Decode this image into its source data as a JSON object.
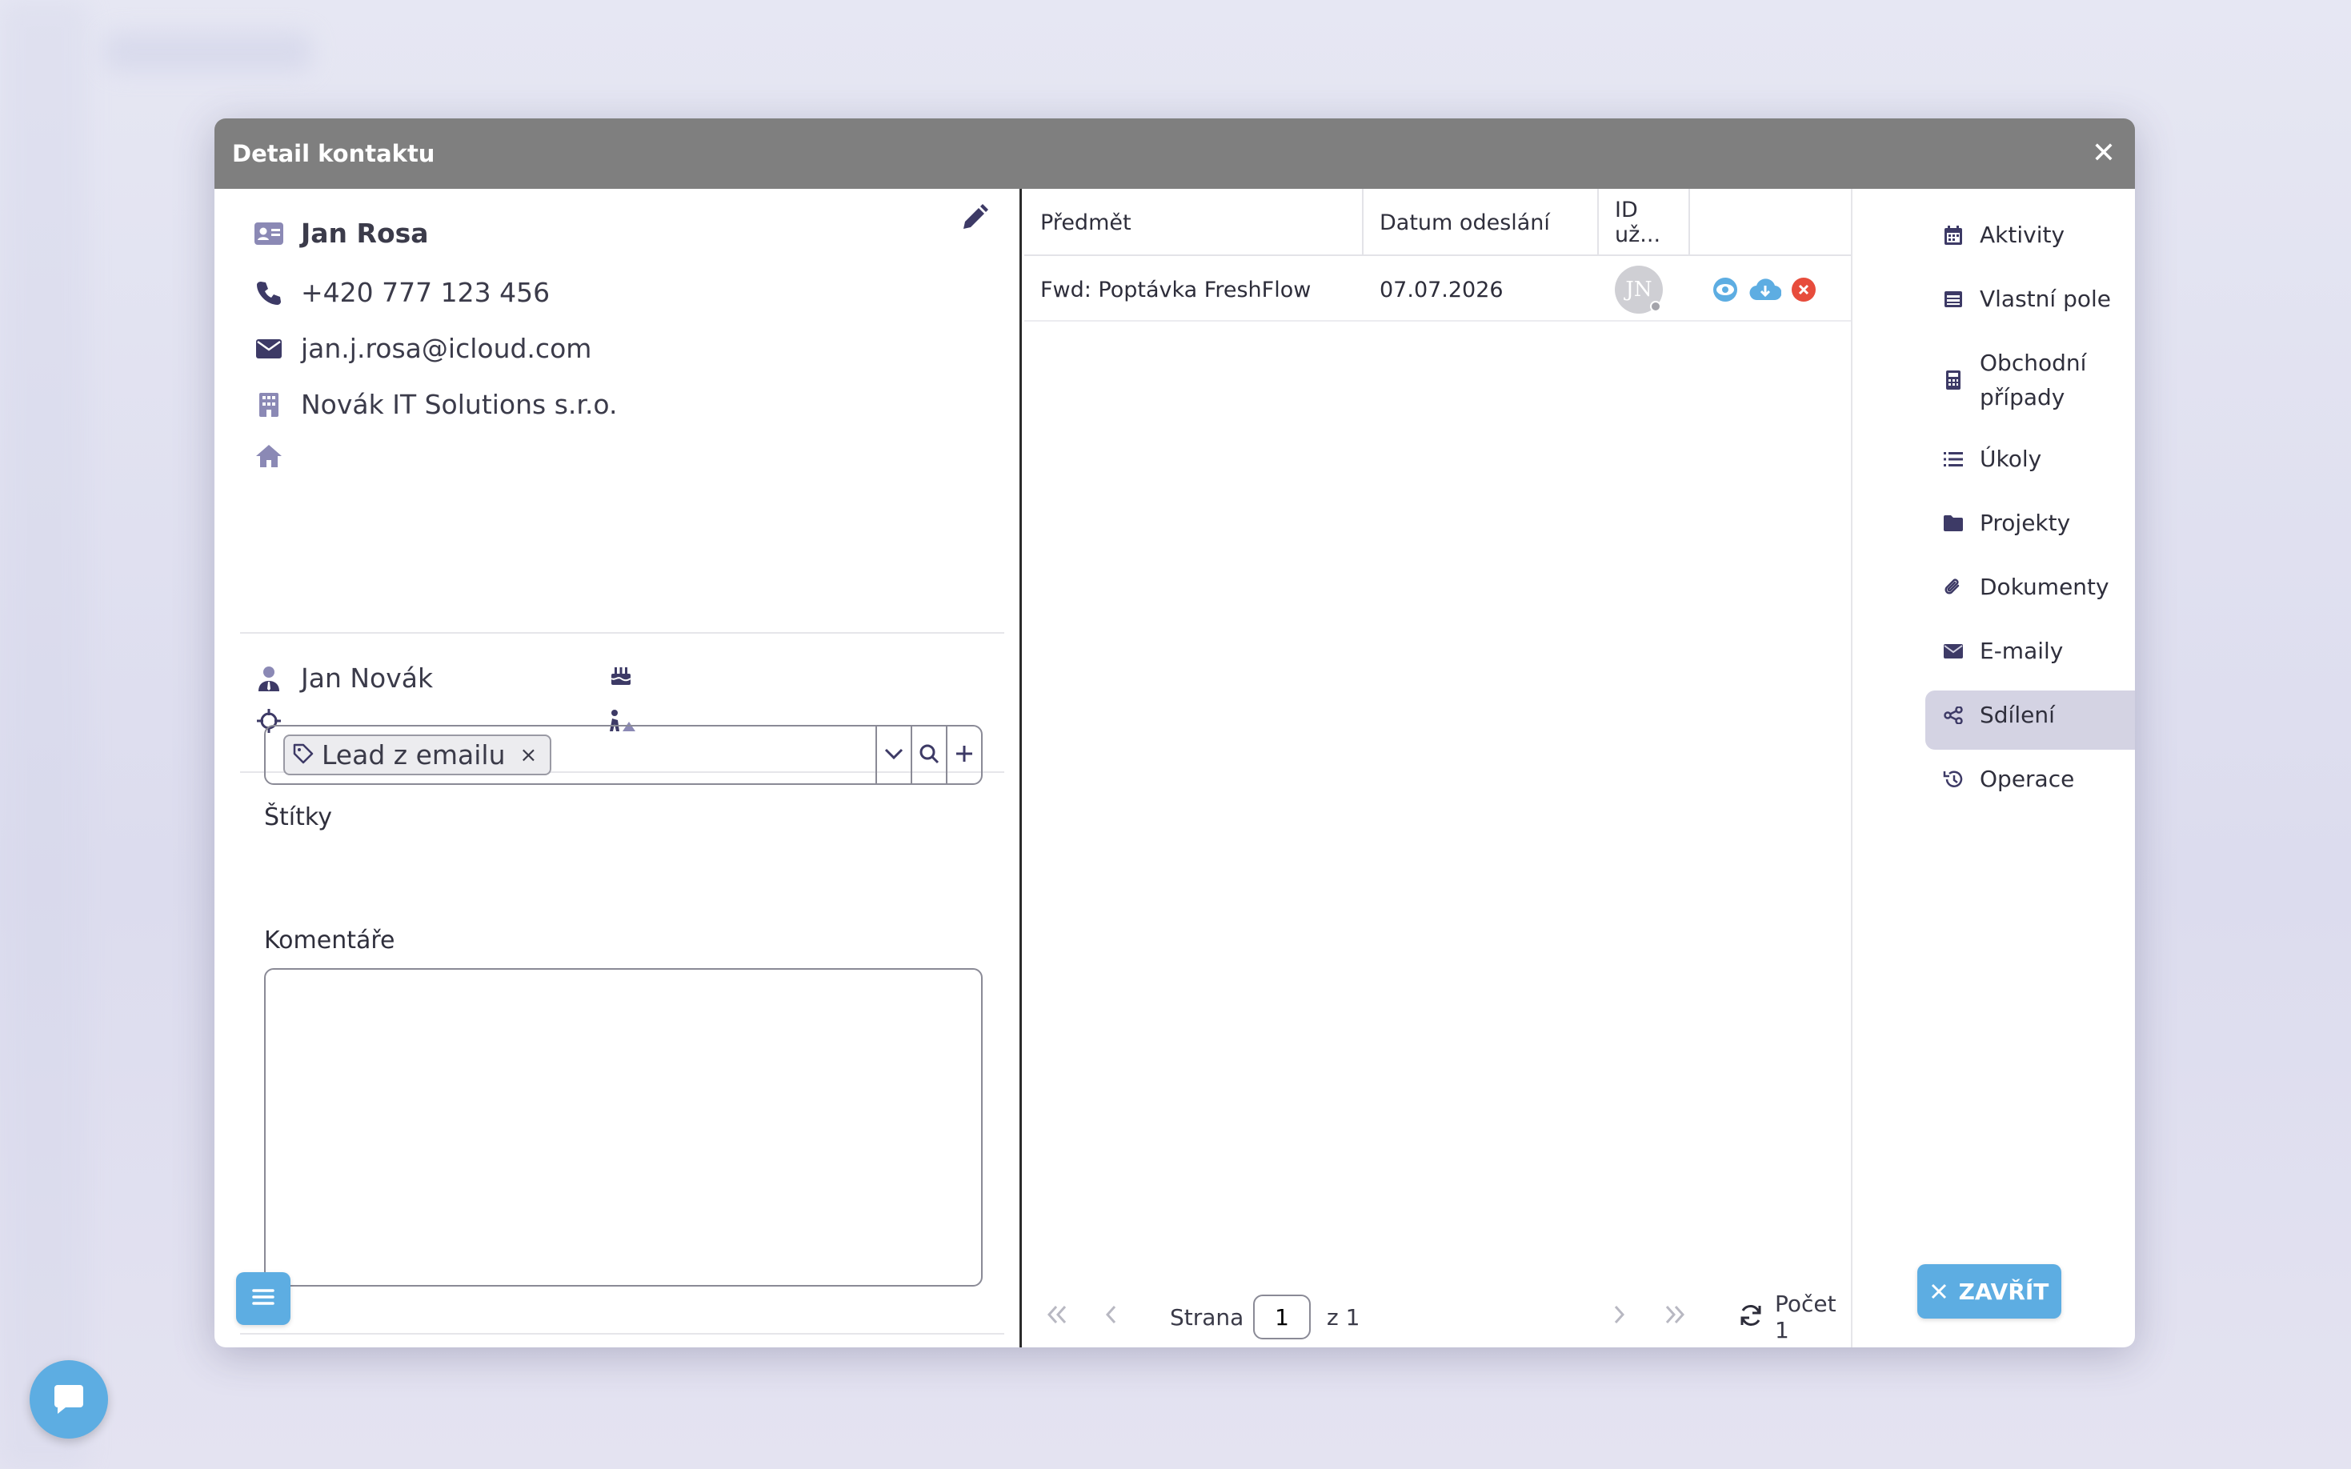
{
  "modal": {
    "title": "Detail kontaktu",
    "close_symbol": "✕"
  },
  "contact": {
    "name": "Jan Rosa",
    "phone": "+420 777 123 456",
    "email": "jan.j.rosa@icloud.com",
    "company": "Novák IT Solutions s.r.o.",
    "address": "",
    "owner": "Jan Novák",
    "birthday": "",
    "position": "",
    "source": ""
  },
  "tags": {
    "label": "Štítky",
    "items": [
      {
        "label": "Lead z emailu",
        "remove_symbol": "×"
      }
    ]
  },
  "comments": {
    "label": "Komentáře",
    "value": ""
  },
  "grid": {
    "columns": [
      "Předmět",
      "Datum odeslání",
      "ID už..."
    ],
    "rows": [
      {
        "subject": "Fwd: Poptávka FreshFlow",
        "date": "07.07.2026",
        "user_initials": "JN"
      }
    ],
    "pager": {
      "page_label": "Strana",
      "page_value": "1",
      "of_label": "z 1",
      "count_label": "Počet 1"
    }
  },
  "nav": {
    "items": [
      {
        "label": "Aktivity",
        "icon": "calendar-icon"
      },
      {
        "label": "Vlastní pole",
        "icon": "table-icon"
      },
      {
        "label": "Obchodní případy",
        "icon": "calculator-icon"
      },
      {
        "label": "Úkoly",
        "icon": "list-icon"
      },
      {
        "label": "Projekty",
        "icon": "folder-icon"
      },
      {
        "label": "Dokumenty",
        "icon": "paperclip-icon"
      },
      {
        "label": "E-maily",
        "icon": "envelope-icon"
      },
      {
        "label": "Sdílení",
        "icon": "share-icon"
      },
      {
        "label": "Operace",
        "icon": "history-icon"
      }
    ],
    "active": "E-maily"
  },
  "footer": {
    "close_label": "ZAVŘÍT"
  },
  "colors": {
    "accent": "#5dade2",
    "header": "#7f7f7f",
    "icon": "#3d3a66",
    "active_nav": "#d4d3e3",
    "danger": "#e74c3c"
  }
}
